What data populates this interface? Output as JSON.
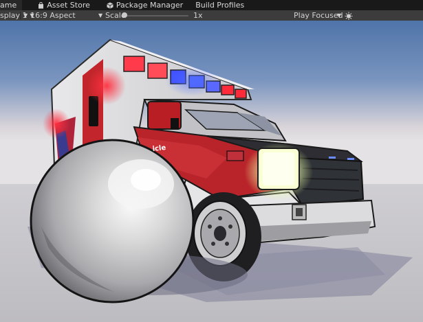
{
  "tabs": [
    {
      "label": "ame",
      "icon": "game-view-icon",
      "active": true
    },
    {
      "label": "Asset Store",
      "icon": "shopping-bag-icon",
      "active": false
    },
    {
      "label": "Package Manager",
      "icon": "package-icon",
      "active": false
    },
    {
      "label": "Build Profiles",
      "icon": "build-profiles-icon",
      "active": false
    }
  ],
  "toolbar": {
    "display_label": "splay 1",
    "aspect_label": "16:9 Aspect",
    "scale_label": "Scale",
    "scale_value": "1x",
    "scale_level": 0,
    "play_mode_label": "Play Focused",
    "settings_icon": "bug-settings-icon"
  },
  "scene": {
    "description_icons": [
      "ambulance",
      "sphere"
    ],
    "colors": {
      "sky_top": "#5a7db0",
      "sky_horizon": "#d9d6dd",
      "ground": "#c9c9cb",
      "cab_red": "#b51d22",
      "beacon_red": "#ff2030",
      "beacon_blue": "#3050ff",
      "headlight": "#fbffd0"
    }
  }
}
